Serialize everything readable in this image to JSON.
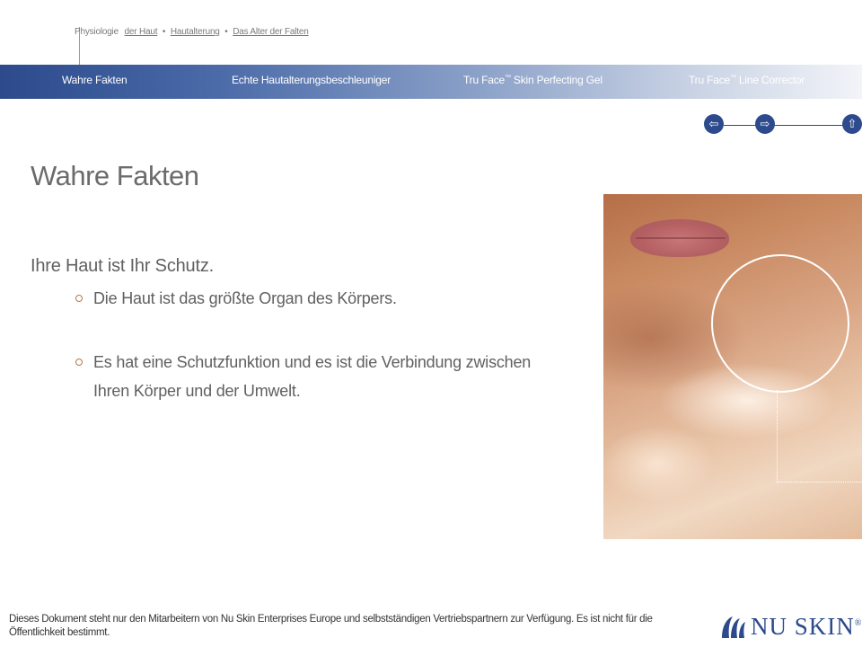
{
  "breadcrumb": {
    "root": "Physiologie",
    "links": [
      "der Haut",
      " Hautalterung",
      "Das Alter der Falten"
    ]
  },
  "nav": {
    "items": [
      {
        "label": "Wahre Fakten",
        "sup": ""
      },
      {
        "label": "Echte Hautalterungsbeschleuniger",
        "sup": ""
      },
      {
        "label": "Tru Face",
        "sup": "™",
        "rest": " Skin Perfecting Gel"
      },
      {
        "label": "Tru Face",
        "sup": "™",
        "rest": " Line Corrector"
      }
    ]
  },
  "arrows": {
    "back": "⇦",
    "forward": "⇨",
    "up": "⇧"
  },
  "content": {
    "title": "Wahre Fakten",
    "lead": "Ihre Haut ist Ihr Schutz.",
    "bullets": [
      "Die Haut ist das größte Organ des Körpers.",
      "Es hat eine Schutzfunktion und es ist die Verbindung zwischen Ihren Körper und der Umwelt."
    ]
  },
  "footer": {
    "disclaimer": "Dieses Dokument steht nur den Mitarbeitern von Nu Skin Enterprises Europe und selbstständigen Vertriebspartnern zur Verfügung. Es ist nicht für die Öffentlichkeit bestimmt."
  },
  "logo": {
    "text": "NU SKIN",
    "mark": "®"
  },
  "colors": {
    "brand": "#2c4a8c",
    "text": "#606060",
    "bullet": "#b07a4a"
  }
}
